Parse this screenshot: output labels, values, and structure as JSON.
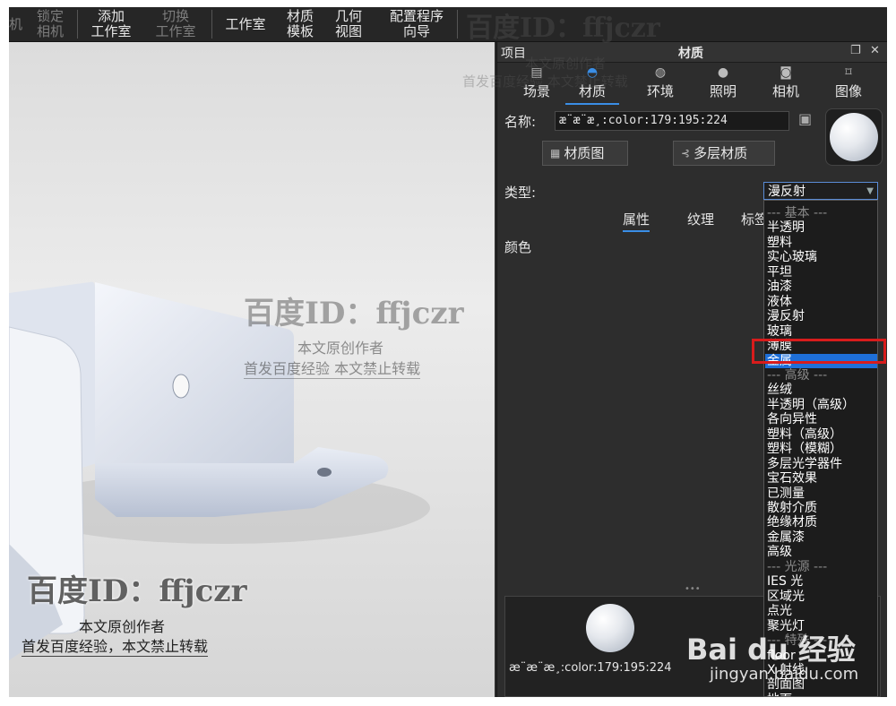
{
  "toolbar": {
    "items": [
      {
        "line1": "机",
        "line2": "",
        "dim": true
      },
      {
        "line1": "锁定",
        "line2": "相机",
        "dim": true
      },
      {
        "line1": "添加",
        "line2": "工作室",
        "dim": false
      },
      {
        "line1": "切换",
        "line2": "工作室",
        "dim": true
      },
      {
        "line1": "工作室",
        "line2": "",
        "dim": false
      },
      {
        "line1": "材质",
        "line2": "模板",
        "dim": false
      },
      {
        "line1": "几何",
        "line2": "视图",
        "dim": false
      },
      {
        "line1": "配置程序",
        "line2": "向导",
        "dim": false
      }
    ]
  },
  "panel": {
    "project_label": "项目",
    "title": "材质",
    "tabs": [
      {
        "label": "场景",
        "icon": "scene-icon"
      },
      {
        "label": "材质",
        "icon": "material-icon"
      },
      {
        "label": "环境",
        "icon": "environment-icon"
      },
      {
        "label": "照明",
        "icon": "lighting-icon"
      },
      {
        "label": "相机",
        "icon": "camera-icon"
      },
      {
        "label": "图像",
        "icon": "image-icon"
      }
    ],
    "name_label": "名称:",
    "name_value": "æ¨æ¨æ¸:color:179:195:224",
    "material_graph_button": "材质图",
    "multilayer_button": "多层材质",
    "type_label": "类型:",
    "type_selected": "漫反射",
    "subtabs": [
      "属性",
      "纹理",
      "标签"
    ],
    "color_label": "颜色",
    "bottom_caption": "æ¨æ¨æ¸:color:179:195:224"
  },
  "dropdown": {
    "options": [
      {
        "label": "--- 基本 ---",
        "kind": "header"
      },
      {
        "label": "半透明",
        "kind": "item"
      },
      {
        "label": "塑料",
        "kind": "item"
      },
      {
        "label": "实心玻璃",
        "kind": "item"
      },
      {
        "label": "平坦",
        "kind": "item"
      },
      {
        "label": "油漆",
        "kind": "item"
      },
      {
        "label": "液体",
        "kind": "item"
      },
      {
        "label": "漫反射",
        "kind": "item"
      },
      {
        "label": "玻璃",
        "kind": "item"
      },
      {
        "label": "薄膜",
        "kind": "item"
      },
      {
        "label": "金属",
        "kind": "selected"
      },
      {
        "label": "--- 高级 ---",
        "kind": "header"
      },
      {
        "label": "丝绒",
        "kind": "item"
      },
      {
        "label": "半透明（高级）",
        "kind": "item"
      },
      {
        "label": "各向异性",
        "kind": "item"
      },
      {
        "label": "塑料（高级）",
        "kind": "item"
      },
      {
        "label": "塑料（模糊）",
        "kind": "item"
      },
      {
        "label": "多层光学器件",
        "kind": "item"
      },
      {
        "label": "宝石效果",
        "kind": "item"
      },
      {
        "label": "已测量",
        "kind": "item"
      },
      {
        "label": "散射介质",
        "kind": "item"
      },
      {
        "label": "绝缘材质",
        "kind": "item"
      },
      {
        "label": "金属漆",
        "kind": "item"
      },
      {
        "label": "高级",
        "kind": "item"
      },
      {
        "label": "--- 光源 ---",
        "kind": "header"
      },
      {
        "label": "IES 光",
        "kind": "item"
      },
      {
        "label": "区域光",
        "kind": "item"
      },
      {
        "label": "点光",
        "kind": "item"
      },
      {
        "label": "聚光灯",
        "kind": "item"
      },
      {
        "label": "--- 特殊 ---",
        "kind": "header"
      },
      {
        "label": "floor",
        "kind": "item"
      },
      {
        "label": "X 射线",
        "kind": "item"
      },
      {
        "label": "剖面图",
        "kind": "item"
      },
      {
        "label": "地面",
        "kind": "item"
      }
    ]
  },
  "watermarks": {
    "id_text": "百度ID：ffjczr",
    "author": "本文原创作者",
    "notice": "首发百度经验 本文禁止转载",
    "notice2": "首发百度经验，本文禁止转载",
    "baidu_logo": "Bai du 经验",
    "url": "jingyan.baidu.com"
  },
  "colors": {
    "accent": "#1e6fd8",
    "highlight_box": "#d81c1c",
    "panel_bg": "#2d2d2d",
    "model_color": "#b3c3e0"
  }
}
